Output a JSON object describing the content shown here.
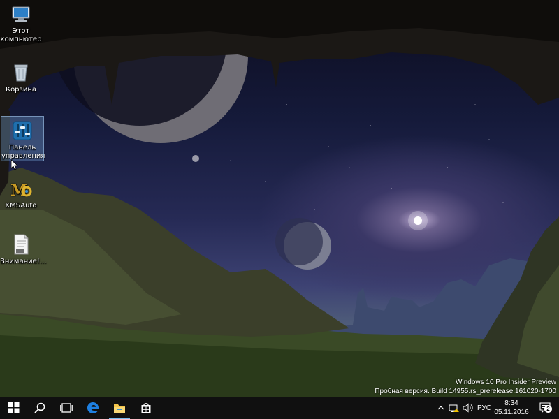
{
  "desktop": {
    "icons": [
      {
        "label": "Этот компьютер",
        "icon": "this-pc-icon"
      },
      {
        "label": "Корзина",
        "icon": "recycle-bin-icon"
      },
      {
        "label": "Панель управления",
        "icon": "control-panel-icon"
      },
      {
        "label": "KMSAuto",
        "icon": "kmsauto-icon"
      },
      {
        "label": "Внимание!...",
        "icon": "text-file-icon"
      }
    ]
  },
  "watermark": {
    "line1": "Windows 10 Pro Insider Preview",
    "line2": "Пробная версия. Build 14955.rs_prerelease.161020-1700"
  },
  "taskbar": {
    "buttons": [
      "windows-start-icon",
      "search-icon",
      "task-view-icon",
      "edge-icon",
      "file-explorer-icon",
      "store-icon"
    ],
    "tray": {
      "language": "РУС",
      "time": "8:34",
      "date": "05.11.2016",
      "notifications_count": "2"
    }
  },
  "colors": {
    "taskbar_bg": "#101010",
    "accent": "#76b9ed"
  }
}
